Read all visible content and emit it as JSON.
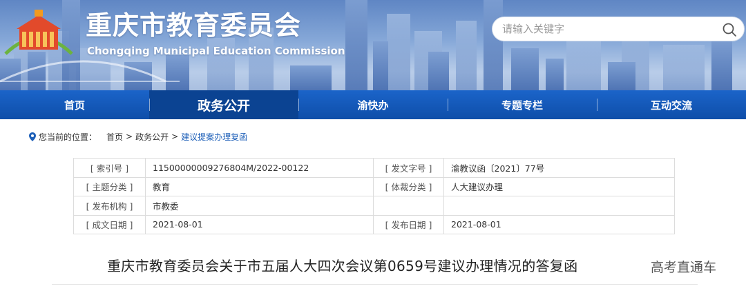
{
  "header": {
    "title": "重庆市教育委员会",
    "subtitle": "Chongqing Municipal Education Commission",
    "search": {
      "placeholder": "请输入关键字"
    }
  },
  "nav": {
    "items": [
      {
        "label": "首页"
      },
      {
        "label": "政务公开",
        "active": true
      },
      {
        "label": "渝快办"
      },
      {
        "label": "专题专栏"
      },
      {
        "label": "互动交流"
      }
    ]
  },
  "breadcrumb": {
    "prefix": "您当前的位置：",
    "items": [
      "首页",
      "政务公开",
      "建议提案办理复函"
    ],
    "separator": ">"
  },
  "info": {
    "rows": [
      {
        "l1": "[ 索引号 ]",
        "v1": "11500000009276804M/2022-00122",
        "l2": "[ 发文字号 ]",
        "v2": "渝教议函〔2021〕77号"
      },
      {
        "l1": "[ 主题分类 ]",
        "v1": "教育",
        "l2": "[ 体裁分类 ]",
        "v2": "人大建议办理"
      },
      {
        "l1": "[ 发布机构 ]",
        "v1": "市教委",
        "l2": "",
        "v2": ""
      },
      {
        "l1": "[ 成文日期 ]",
        "v1": "2021-08-01",
        "l2": "[ 发布日期 ]",
        "v2": "2021-08-01"
      }
    ]
  },
  "article": {
    "title": "重庆市教育委员会关于市五届人大四次会议第0659号建议办理情况的答复函"
  },
  "watermark": "高考直通车",
  "colors": {
    "nav_blue": "#1b64c9",
    "nav_active": "#0b4392",
    "link_blue": "#1d5fb8",
    "banner_sky": "#86a8d8"
  }
}
